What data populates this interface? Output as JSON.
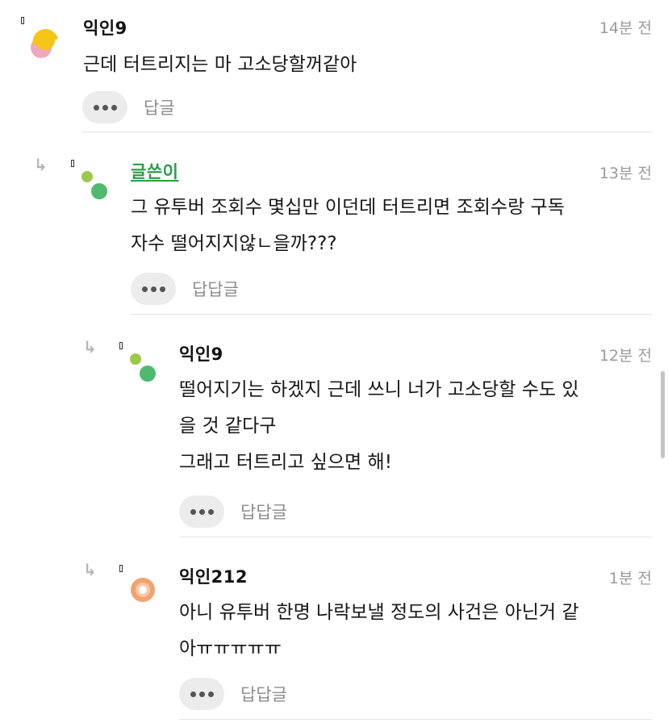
{
  "comments": [
    {
      "author": "익인9",
      "time": "14분 전",
      "text": "근데 터트리지는 마 고소당할꺼같아",
      "reply_label": "답글"
    },
    {
      "author": "글쓴이",
      "time": "13분 전",
      "text": "그 유투버 조회수 몇십만 이던데 터트리면 조회수랑 구독\n자수 떨어지지않ㄴ을까???",
      "reply_label": "답답글"
    },
    {
      "author": "익인9",
      "time": "12분 전",
      "text": "떨어지기는 하겠지 근데 쓰니 너가 고소당할 수도 있\n을 것 같다구\n그래고 터트리고 싶으면 해!",
      "reply_label": "답답글"
    },
    {
      "author": "익인212",
      "time": "1분 전",
      "text": "아니 유투버 한명 나락보낼 정도의 사건은 아닌거 같\n아ㅠㅠㅠㅠㅠ",
      "reply_label": "답답글"
    }
  ],
  "icons": {
    "reply_arrow": "reply-arrow-icon",
    "more": "more-options-icon"
  },
  "colors": {
    "author_name": "#2f9a4c",
    "avatar_yellow": "#f5c518",
    "avatar_pink": "#f0a8bf",
    "avatar_green_small": "#9bc94a",
    "avatar_green_large": "#4fba6f",
    "avatar_orange": "#f2a271"
  }
}
